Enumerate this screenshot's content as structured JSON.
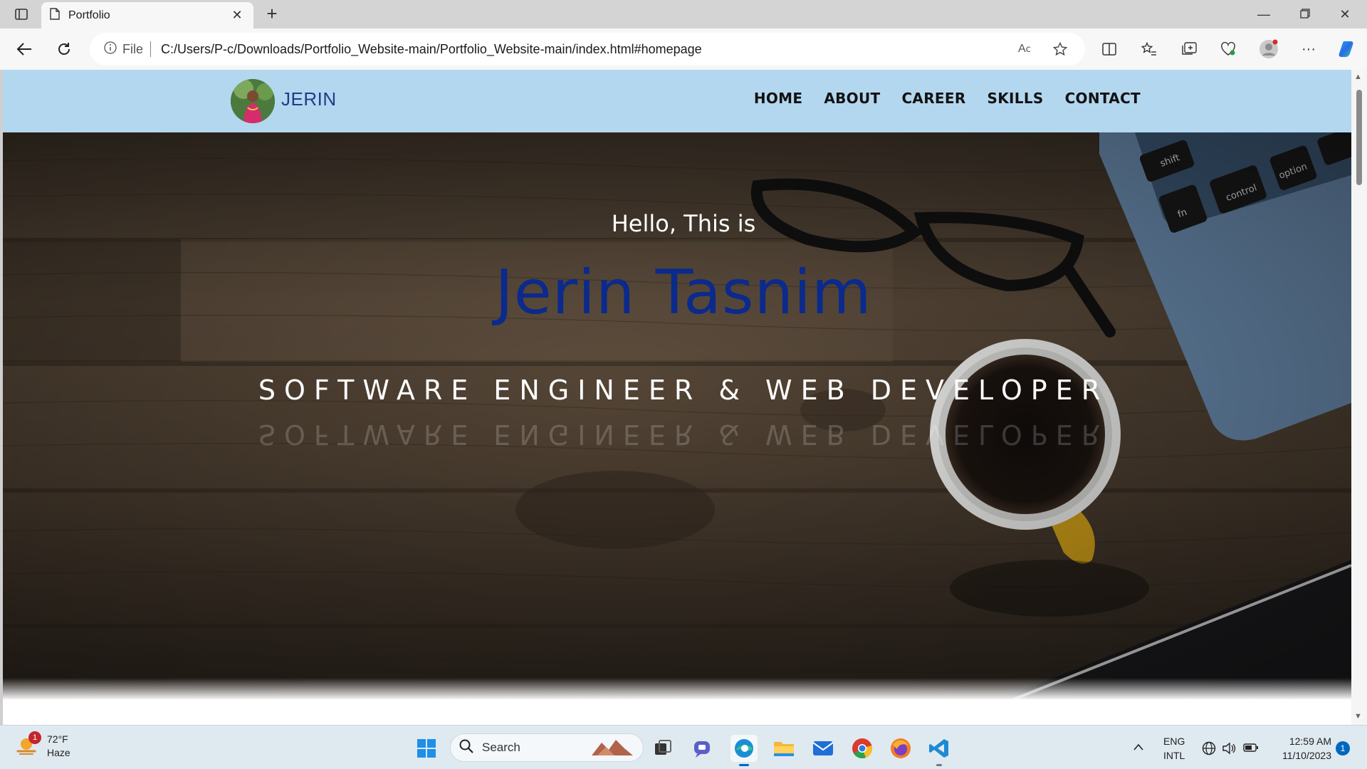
{
  "browser": {
    "tab_title": "Portfolio",
    "address_scheme": "File",
    "url": "C:/Users/P-c/Downloads/Portfolio_Website-main/Portfolio_Website-main/index.html#homepage"
  },
  "site": {
    "logo_text": "JERIN",
    "nav": [
      {
        "label": "HOME"
      },
      {
        "label": "ABOUT"
      },
      {
        "label": "CAREER"
      },
      {
        "label": "SKILLS"
      },
      {
        "label": "CONTACT"
      }
    ],
    "hero": {
      "greeting": "Hello, This is",
      "name": "Jerin Tasnim",
      "role": "SOFTWARE ENGINEER & WEB DEVELOPER"
    }
  },
  "taskbar": {
    "weather_temp": "72°F",
    "weather_condition": "Haze",
    "weather_badge": "1",
    "search_label": "Search",
    "lang_line1": "ENG",
    "lang_line2": "INTL",
    "time": "12:59 AM",
    "date": "11/10/2023",
    "notification_count": "1"
  },
  "colors": {
    "header_bg": "#b3d7ef",
    "name_color": "#0b2a8c",
    "logo_color": "#1f3d8a"
  }
}
